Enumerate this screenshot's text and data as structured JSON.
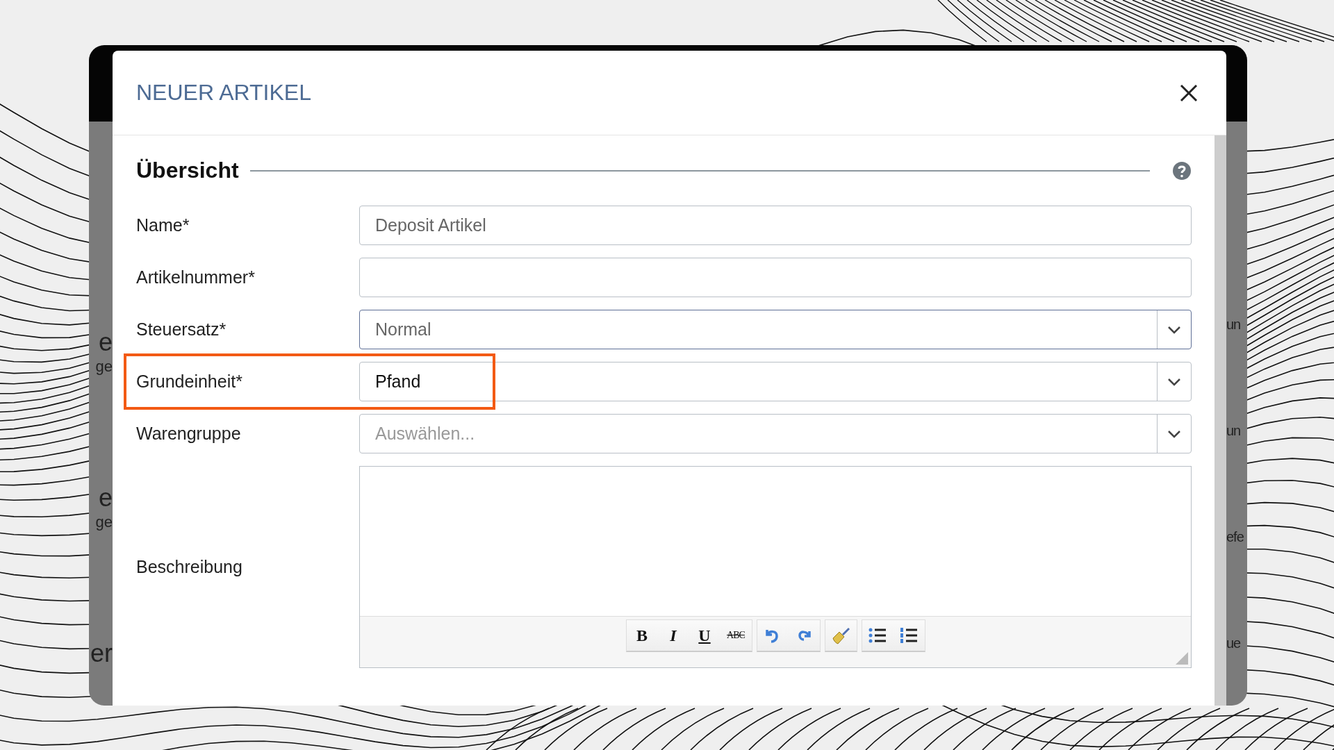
{
  "window": {
    "title": "NEUER ARTIKEL"
  },
  "section": {
    "title": "Übersicht"
  },
  "fields": [
    {
      "kind": "text",
      "label": "Name*",
      "value": "Deposit Artikel"
    },
    {
      "kind": "text",
      "label": "Artikelnummer*"
    },
    {
      "kind": "select",
      "label": "Steuersatz*",
      "value": "Normal",
      "focused": true
    },
    {
      "kind": "select",
      "label": "Grundeinheit*",
      "value": "Pfand",
      "highlighted": true
    },
    {
      "kind": "select",
      "label": "Warengruppe",
      "placeholder": "Auswählen..."
    },
    {
      "kind": "richtext",
      "label": "Beschreibung"
    }
  ],
  "editor_toolbar": [
    [
      {
        "kind": "bold",
        "label": "B"
      },
      {
        "kind": "italic",
        "label": "I"
      },
      {
        "kind": "underline",
        "label": "U"
      },
      {
        "kind": "strike",
        "label": "ABC"
      }
    ],
    [
      {
        "kind": "undo"
      },
      {
        "kind": "redo"
      }
    ],
    [
      {
        "kind": "clear"
      }
    ],
    [
      {
        "kind": "bullets"
      },
      {
        "kind": "numbers"
      }
    ]
  ],
  "background_fragments": {
    "left": [
      "e",
      "ge",
      "e",
      "ge",
      "er"
    ],
    "right": [
      "un",
      "un",
      "efe",
      "ue"
    ]
  }
}
